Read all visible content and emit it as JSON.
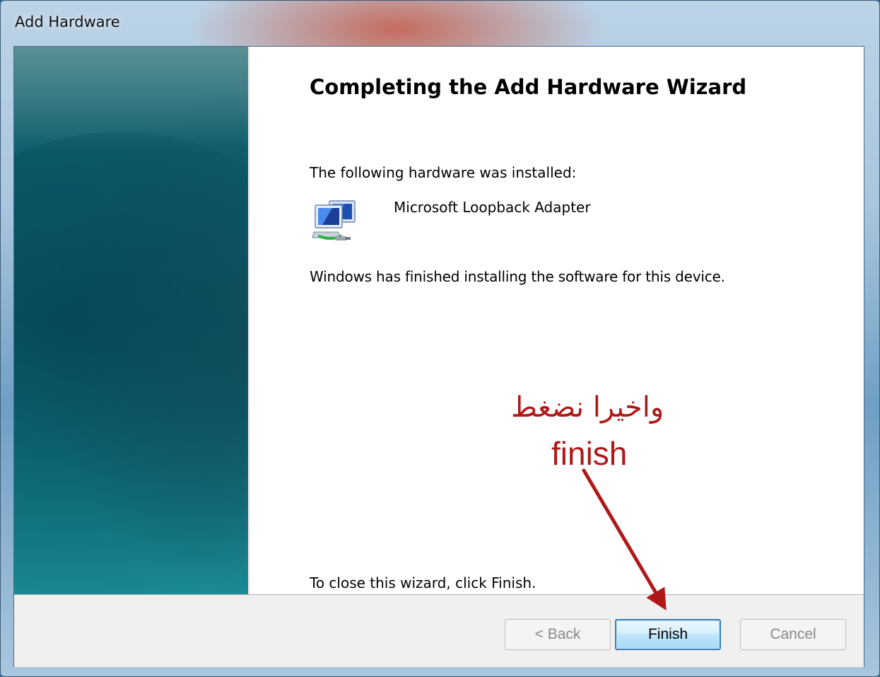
{
  "window": {
    "title": "Add Hardware"
  },
  "wizard": {
    "heading": "Completing the Add Hardware Wizard",
    "installed_label": "The following hardware was installed:",
    "device_name": "Microsoft Loopback Adapter",
    "device_icon": "network-adapter-icon",
    "finished_text": "Windows has finished installing the software for this device.",
    "close_text": "To close this wizard, click Finish."
  },
  "buttons": {
    "back_label": "< Back",
    "finish_label": "Finish",
    "cancel_label": "Cancel"
  },
  "annotation": {
    "arabic_text": "واخيرا نضغط",
    "english_text": "finish",
    "color": "#b01818"
  },
  "colors": {
    "side_panel": "#0d5f6e",
    "finish_border": "#3c7fb1"
  }
}
